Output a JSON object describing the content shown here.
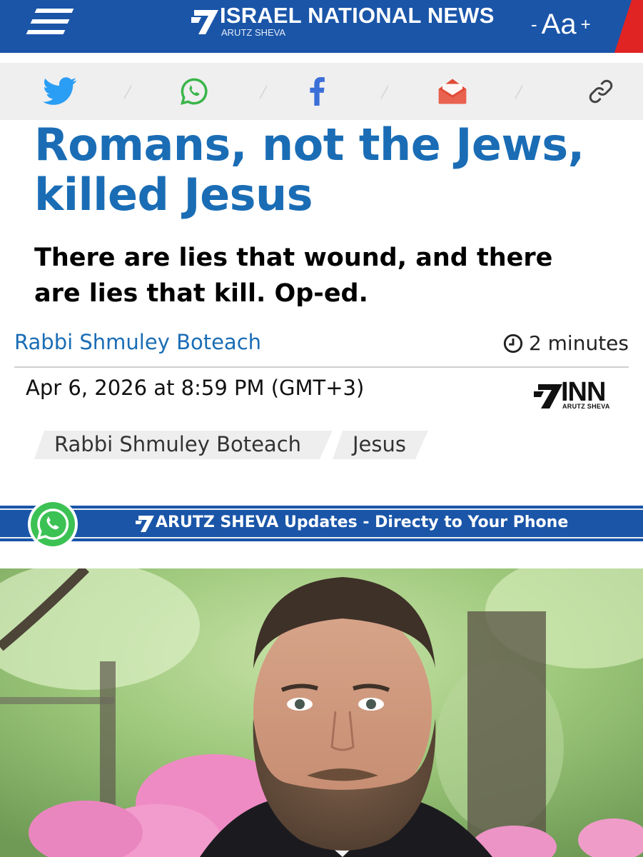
{
  "header": {
    "brand_name": "ISRAEL NATIONAL NEWS",
    "brand_sub": "ARUTZ SHEVA",
    "font_minus": "-",
    "font_label": "Aa",
    "font_plus": "+",
    "colors": {
      "header_bg": "#1a55a8",
      "accent_red": "#e02424"
    }
  },
  "share": {
    "items": [
      {
        "icon": "twitter-icon"
      },
      {
        "icon": "whatsapp-icon"
      },
      {
        "icon": "facebook-icon"
      },
      {
        "icon": "email-icon"
      },
      {
        "icon": "link-icon"
      }
    ]
  },
  "article": {
    "title_line1": "Romans, not the Jews,",
    "title_line2": "killed Jesus",
    "subtitle_line1": "There are lies that wound, and there",
    "subtitle_line2": "are lies that kill. Op-ed.",
    "author": "Rabbi Shmuley Boteach",
    "read_time": "2 minutes",
    "date": "Apr 6, 2026 at 8:59 PM (GMT+3)",
    "publisher_logo": "INN",
    "publisher_logo_sub": "ARUTZ SHEVA",
    "tags": [
      "Rabbi Shmuley Boteach",
      "Jesus"
    ],
    "title_color": "#1a6db5"
  },
  "banner": {
    "text": "ARUTZ SHEVA Updates - Directy to Your Phone"
  }
}
